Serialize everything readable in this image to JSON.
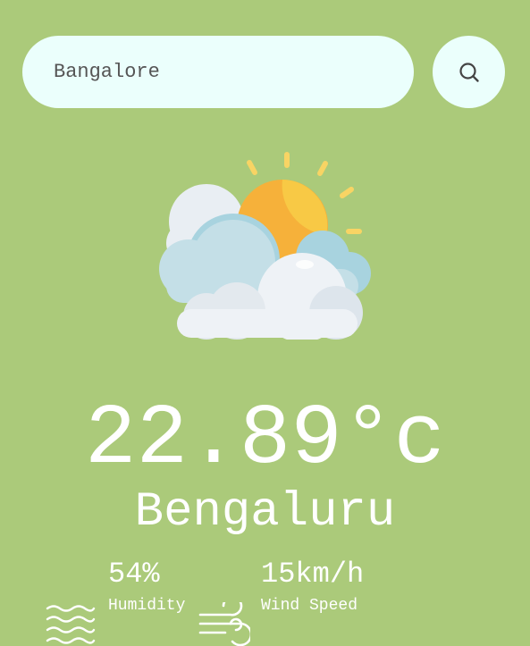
{
  "search": {
    "value": "Bangalore",
    "button_icon": "search-icon"
  },
  "weather": {
    "icon": "partly-cloudy-icon",
    "temperature": "22.89°c",
    "city": "Bengaluru"
  },
  "details": {
    "humidity": {
      "icon": "humidity-icon",
      "value": "54%",
      "label": "Humidity"
    },
    "wind": {
      "icon": "wind-icon",
      "value": "15km/h",
      "label": "Wind Speed"
    }
  },
  "colors": {
    "background": "#abca7a",
    "search_bg": "#ebfffc",
    "text": "#ffffff",
    "sun": "#f8c542",
    "sun_rays": "#f8d464",
    "cloud_back": "#a8d3df",
    "cloud_front": "#eef2f6"
  }
}
